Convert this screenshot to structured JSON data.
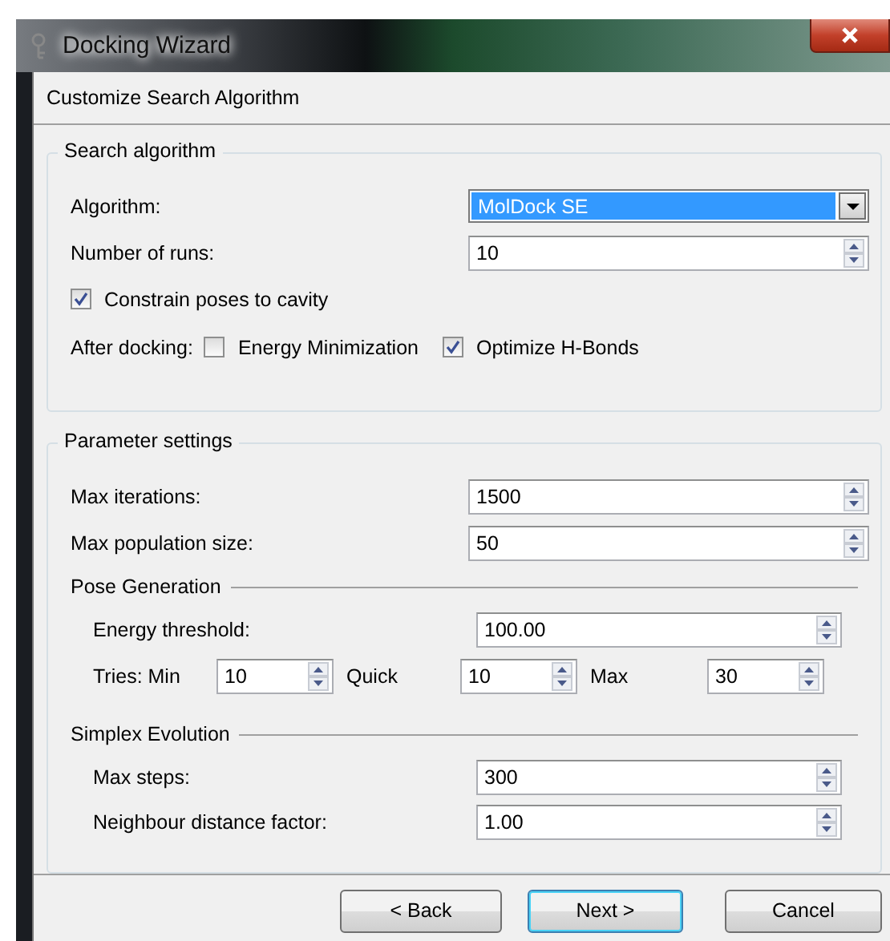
{
  "window": {
    "title": "Docking Wizard"
  },
  "page_title": "Customize Search Algorithm",
  "search_algorithm": {
    "title": "Search algorithm",
    "algorithm": {
      "label": "Algorithm:",
      "value": "MolDock SE"
    },
    "runs": {
      "label": "Number of runs:",
      "value": "10"
    },
    "constrain": {
      "label": "Constrain poses to cavity",
      "checked": true
    },
    "after_docking": {
      "label": "After docking:",
      "options": [
        {
          "label": "Energy Minimization",
          "checked": false
        },
        {
          "label": "Optimize H-Bonds",
          "checked": true
        }
      ]
    }
  },
  "parameter_settings": {
    "title": "Parameter settings",
    "fields": [
      {
        "label": "Max iterations:",
        "value": "1500"
      },
      {
        "label": "Max population size:",
        "value": "50"
      }
    ],
    "sections": [
      {
        "title": "Pose Generation",
        "fields": [
          {
            "label": "Energy threshold:",
            "value": "100.00"
          }
        ],
        "tries": [
          {
            "label": "Tries: Min",
            "value": "10"
          },
          {
            "label": "Quick",
            "value": "10"
          },
          {
            "label": "Max",
            "value": "30"
          }
        ]
      },
      {
        "title": "Simplex Evolution",
        "fields": [
          {
            "label": "Max steps:",
            "value": "300"
          },
          {
            "label": "Neighbour distance factor:",
            "value": "1.00"
          }
        ]
      }
    ]
  },
  "buttons": [
    {
      "label": "< Back",
      "default": false
    },
    {
      "label": "Next >",
      "default": true
    },
    {
      "label": "Cancel",
      "default": false
    }
  ]
}
